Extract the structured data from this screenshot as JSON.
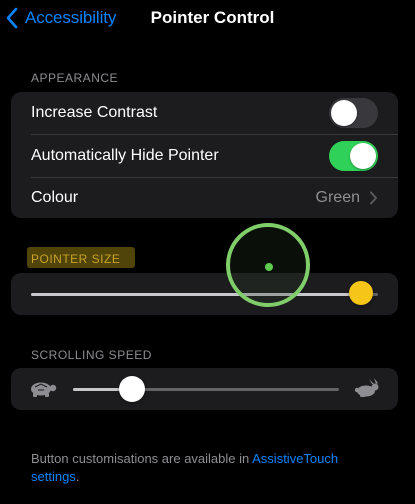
{
  "nav": {
    "back_label": "Accessibility",
    "title": "Pointer Control"
  },
  "appearance": {
    "header": "APPEARANCE",
    "rows": [
      {
        "label": "Increase Contrast",
        "toggle_on": false
      },
      {
        "label": "Automatically Hide Pointer",
        "toggle_on": true
      },
      {
        "label": "Colour",
        "value": "Green"
      }
    ]
  },
  "pointer_size": {
    "header": "POINTER SIZE",
    "level": 0.95
  },
  "scrolling_speed": {
    "header": "SCROLLING SPEED",
    "level": 0.22,
    "slow_icon": "turtle-icon",
    "fast_icon": "rabbit-icon"
  },
  "footer": {
    "text_before": "Button customisations are available in ",
    "link_text": "AssistiveTouch settings",
    "text_after": "."
  },
  "colors": {
    "accent": "#0a84ff",
    "toggle_on": "#30d158",
    "pointer": "#7fce6a",
    "pointer_size_knob": "#f5c518",
    "highlight": "#b49614"
  }
}
